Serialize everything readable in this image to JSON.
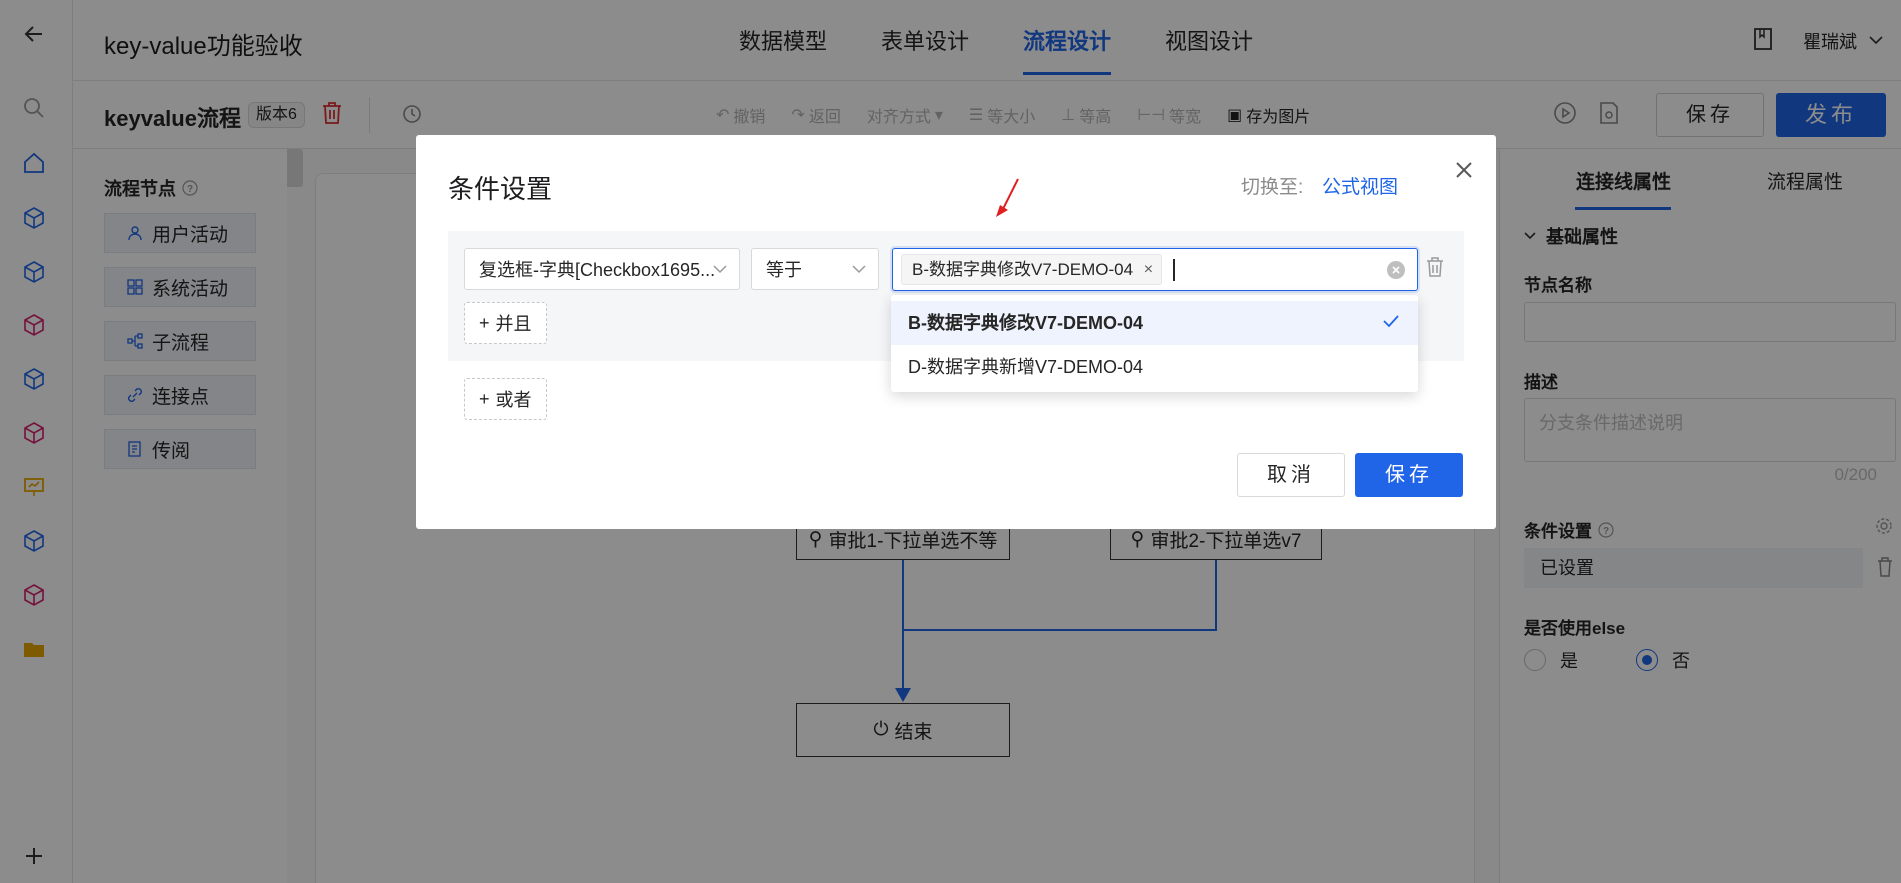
{
  "header": {
    "app_title": "key-value功能验收",
    "tabs": [
      {
        "label": "数据模型"
      },
      {
        "label": "表单设计"
      },
      {
        "label": "流程设计"
      },
      {
        "label": "视图设计"
      }
    ],
    "user_name": "瞿瑞斌"
  },
  "toolbar": {
    "flow_name": "keyvalue流程",
    "version": "版本6",
    "undo": "撤销",
    "back": "返回",
    "align": "对齐方式",
    "same_size": "等大小",
    "same_height": "等高",
    "same_width": "等宽",
    "save_image": "存为图片",
    "save": "保存",
    "publish": "发布"
  },
  "palette": {
    "title": "流程节点",
    "nodes": [
      {
        "label": "用户活动"
      },
      {
        "label": "系统活动"
      },
      {
        "label": "子流程"
      },
      {
        "label": "连接点"
      },
      {
        "label": "传阅"
      }
    ]
  },
  "canvas": {
    "node_approve1": "审批1-下拉单选不等",
    "node_approve2": "审批2-下拉单选v7",
    "node_end": "结束"
  },
  "right_panel": {
    "tab_line": "连接线属性",
    "tab_flow": "流程属性",
    "section": "基础属性",
    "node_name_label": "节点名称",
    "desc_label": "描述",
    "desc_placeholder": "分支条件描述说明",
    "desc_count": "0/200",
    "cond_label": "条件设置",
    "cond_status": "已设置",
    "else_label": "是否使用else",
    "else_yes": "是",
    "else_no": "否",
    "else_value": "否"
  },
  "modal": {
    "title": "条件设置",
    "switch_label": "切换至:",
    "switch_link": "公式视图",
    "field_select": "复选框-字典[Checkbox1695...",
    "operator_select": "等于",
    "selected_tag": "B-数据字典修改V7-DEMO-04",
    "and_button": "并且",
    "or_button": "或者",
    "options": [
      {
        "label": "B-数据字典修改V7-DEMO-04",
        "selected": true
      },
      {
        "label": "D-数据字典新增V7-DEMO-04",
        "selected": false
      }
    ],
    "cancel": "取消",
    "save": "保存"
  },
  "colors": {
    "accent": "#2065e8",
    "annotation_arrow": "#e02020"
  }
}
